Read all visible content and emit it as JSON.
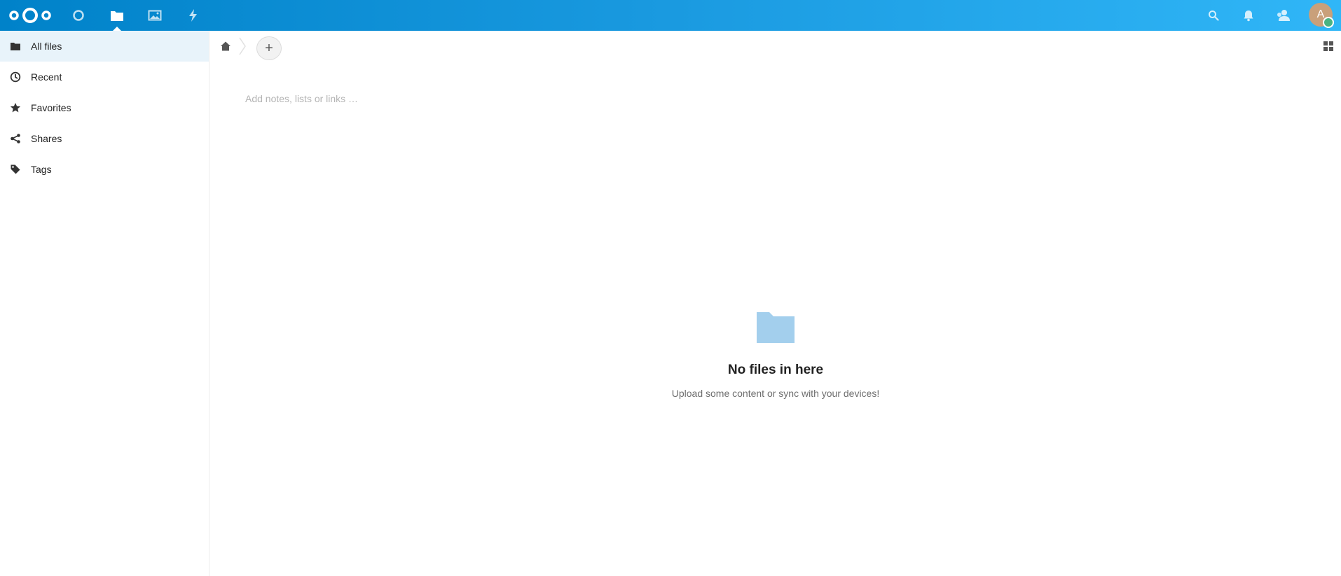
{
  "header": {
    "apps": [
      {
        "name": "dashboard",
        "icon": "circle-icon",
        "active": false
      },
      {
        "name": "files",
        "icon": "folder-icon",
        "active": true
      },
      {
        "name": "photos",
        "icon": "image-icon",
        "active": false
      },
      {
        "name": "activity",
        "icon": "lightning-icon",
        "active": false
      }
    ],
    "right_icons": [
      "search-icon",
      "bell-icon",
      "contacts-icon"
    ],
    "avatar_initial": "A",
    "accent_color": "#0082c9",
    "status_color": "#49b382"
  },
  "sidebar": {
    "items": [
      {
        "label": "All files",
        "icon": "folder-icon",
        "active": true
      },
      {
        "label": "Recent",
        "icon": "clock-icon",
        "active": false
      },
      {
        "label": "Favorites",
        "icon": "star-icon",
        "active": false
      },
      {
        "label": "Shares",
        "icon": "share-icon",
        "active": false
      },
      {
        "label": "Tags",
        "icon": "tag-icon",
        "active": false
      }
    ]
  },
  "controls": {
    "add_symbol": "+"
  },
  "notes": {
    "placeholder": "Add notes, lists or links …"
  },
  "empty": {
    "title": "No files in here",
    "subtitle": "Upload some content or sync with your devices!"
  }
}
